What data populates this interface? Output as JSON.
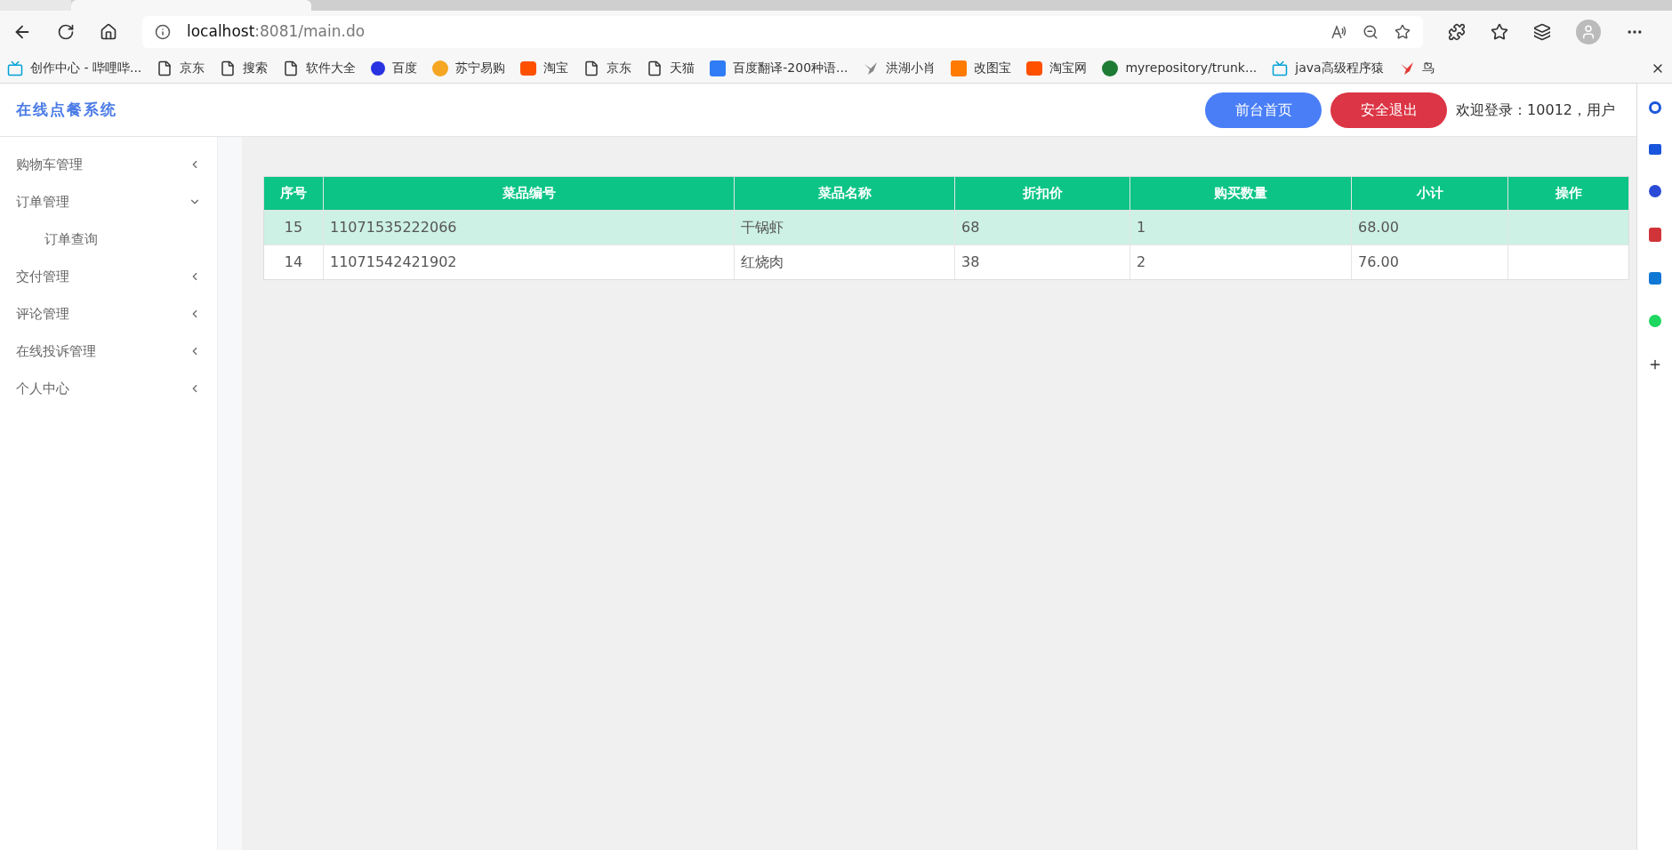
{
  "browser": {
    "address": {
      "host": "localhost",
      "rest": ":8081/main.do"
    },
    "bookmarks": [
      {
        "label": "创作中心 - 哔哩哔...",
        "kind": "tv",
        "color": "#00a1d6"
      },
      {
        "label": "京东",
        "kind": "page",
        "color": "#333333"
      },
      {
        "label": "搜索",
        "kind": "page",
        "color": "#333333"
      },
      {
        "label": "软件大全",
        "kind": "page",
        "color": "#333333"
      },
      {
        "label": "百度",
        "kind": "paw",
        "color": "#2932e1"
      },
      {
        "label": "苏宁易购",
        "kind": "sun",
        "color": "#f5a623"
      },
      {
        "label": "淘宝",
        "kind": "tao",
        "color": "#ff5000"
      },
      {
        "label": "京东",
        "kind": "page",
        "color": "#333333"
      },
      {
        "label": "天猫",
        "kind": "page",
        "color": "#333333"
      },
      {
        "label": "百度翻译-200种语...",
        "kind": "square",
        "color": "#2f7cf6"
      },
      {
        "label": "洪湖小肖",
        "kind": "bird",
        "color": "#888888"
      },
      {
        "label": "改图宝",
        "kind": "square",
        "color": "#ff7a00"
      },
      {
        "label": "淘宝网",
        "kind": "tao",
        "color": "#ff5000"
      },
      {
        "label": "myrepository/trunk...",
        "kind": "circle",
        "color": "#1e7b34"
      },
      {
        "label": "java高级程序猿",
        "kind": "tv",
        "color": "#00a1d6"
      },
      {
        "label": "鸟",
        "kind": "bird",
        "color": "#e53935"
      }
    ]
  },
  "header": {
    "title": "在线点餐系统",
    "buttons": [
      {
        "label": "前台首页",
        "kind": "primary"
      },
      {
        "label": "安全退出",
        "kind": "danger"
      }
    ],
    "welcome": "欢迎登录：10012，用户"
  },
  "sidebar": {
    "items": [
      {
        "label": "购物车管理",
        "expanded": false
      },
      {
        "label": "订单管理",
        "expanded": true,
        "children": [
          {
            "label": "订单查询"
          }
        ]
      },
      {
        "label": "交付管理",
        "expanded": false
      },
      {
        "label": "评论管理",
        "expanded": false
      },
      {
        "label": "在线投诉管理",
        "expanded": false
      },
      {
        "label": "个人中心",
        "expanded": false
      }
    ]
  },
  "table": {
    "columns": [
      "序号",
      "菜品编号",
      "菜品名称",
      "折扣价",
      "购买数量",
      "小计",
      "操作"
    ],
    "rows": [
      {
        "highlighted": true,
        "cells": [
          "15",
          "11071535222066",
          "干锅虾",
          "68",
          "1",
          "68.00",
          ""
        ]
      },
      {
        "highlighted": false,
        "cells": [
          "14",
          "11071542421902",
          "红烧肉",
          "38",
          "2",
          "76.00",
          ""
        ]
      }
    ]
  }
}
